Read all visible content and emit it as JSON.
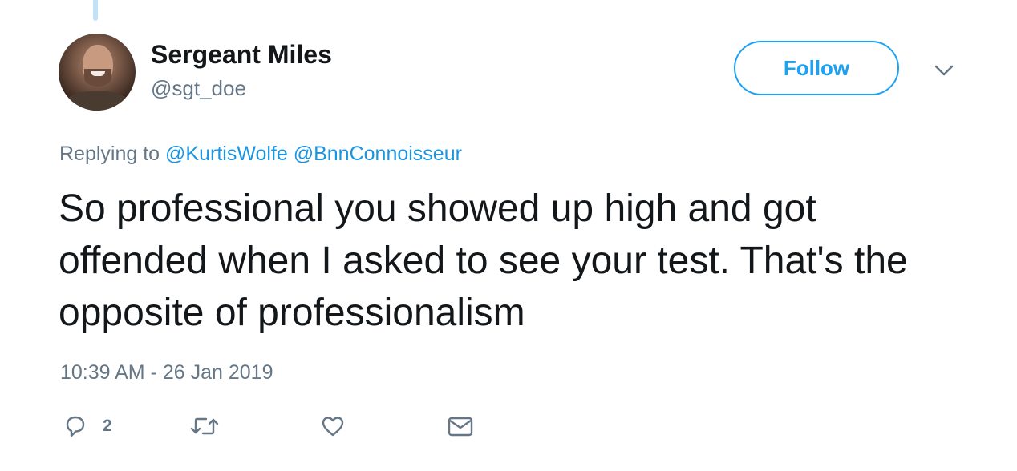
{
  "tweet": {
    "author_name": "Sergeant Miles",
    "author_handle": "@sgt_doe",
    "follow_label": "Follow",
    "replying_prefix": "Replying to",
    "reply_mentions": [
      "@KurtisWolfe",
      "@BnnConnoisseur"
    ],
    "text": "So professional you showed up high and got offended when I asked to see your test. That's the opposite of professionalism",
    "timestamp": "10:39 AM - 26 Jan 2019",
    "reply_count": "2"
  },
  "icons": {
    "menu": "chevron-down-icon",
    "reply": "reply-icon",
    "retweet": "retweet-icon",
    "like": "heart-icon",
    "dm": "envelope-icon"
  },
  "colors": {
    "accent": "#1da1f2",
    "mention": "#1b95e0",
    "secondary_text": "#657786",
    "primary_text": "#14171a"
  }
}
